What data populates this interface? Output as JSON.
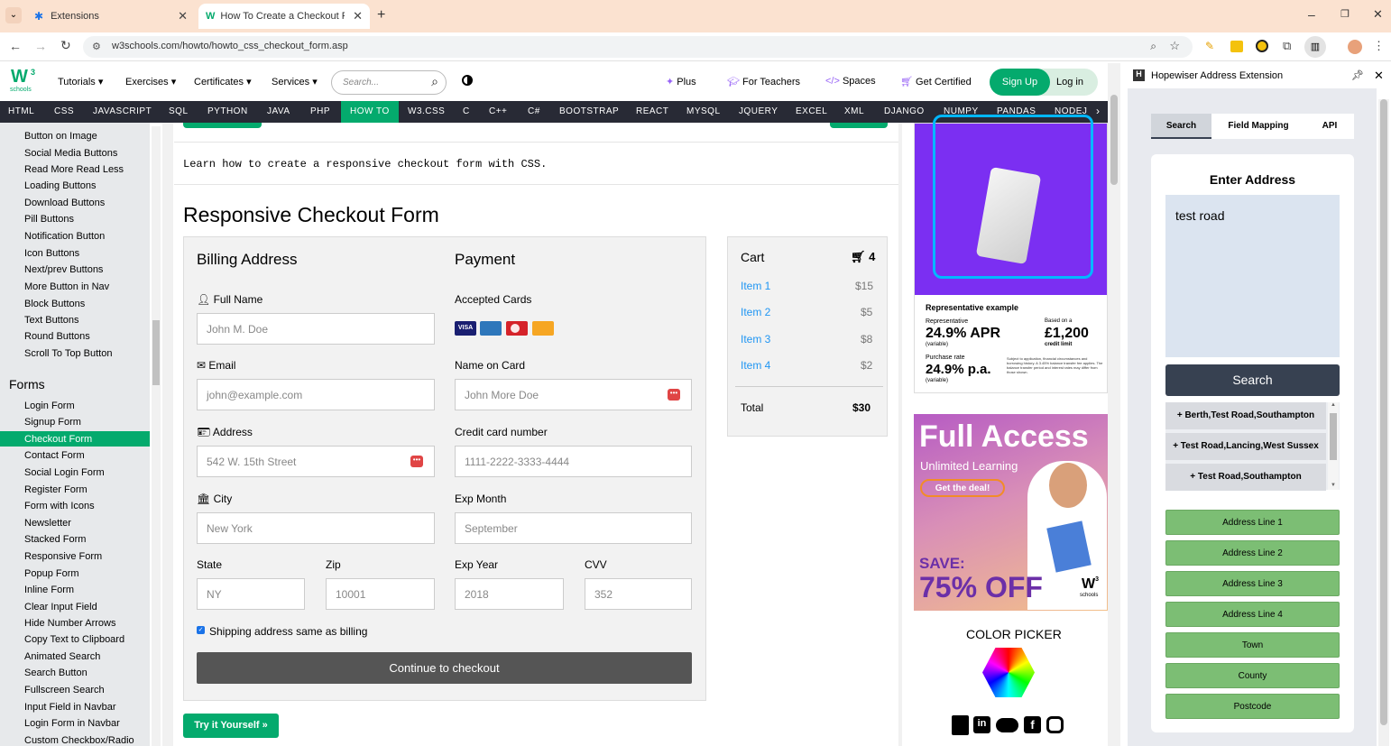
{
  "browser": {
    "tabs": [
      {
        "label": "Extensions"
      },
      {
        "label": "How To Create a Checkout Form"
      }
    ],
    "url": "w3schools.com/howto/howto_css_checkout_form.asp"
  },
  "w3": {
    "logo_text": "schools",
    "nav": [
      "Tutorials",
      "Exercises",
      "Certificates",
      "Services"
    ],
    "search_placeholder": "Search...",
    "right_nav": [
      "Plus",
      "For Teachers",
      "Spaces",
      "Get Certified"
    ],
    "signup": "Sign Up",
    "login": "Log in",
    "topnav": [
      "HTML",
      "CSS",
      "JAVASCRIPT",
      "SQL",
      "PYTHON",
      "JAVA",
      "PHP",
      "HOW TO",
      "W3.CSS",
      "C",
      "C++",
      "C#",
      "BOOTSTRAP",
      "REACT",
      "MYSQL",
      "JQUERY",
      "EXCEL",
      "XML",
      "DJANGO",
      "NUMPY",
      "PANDAS",
      "NODEJ"
    ],
    "active_topnav": "HOW TO"
  },
  "sidebar": {
    "items_top": [
      "Button on Image",
      "Social Media Buttons",
      "Read More Read Less",
      "Loading Buttons",
      "Download Buttons",
      "Pill Buttons",
      "Notification Button",
      "Icon Buttons",
      "Next/prev Buttons",
      "More Button in Nav",
      "Block Buttons",
      "Text Buttons",
      "Round Buttons",
      "Scroll To Top Button"
    ],
    "section": "Forms",
    "items_forms": [
      "Login Form",
      "Signup Form",
      "Checkout Form",
      "Contact Form",
      "Social Login Form",
      "Register Form",
      "Form with Icons",
      "Newsletter",
      "Stacked Form",
      "Responsive Form",
      "Popup Form",
      "Inline Form",
      "Clear Input Field",
      "Hide Number Arrows",
      "Copy Text to Clipboard",
      "Animated Search",
      "Search Button",
      "Fullscreen Search",
      "Input Field in Navbar",
      "Login Form in Navbar",
      "Custom Checkbox/Radio"
    ],
    "active": "Checkout Form"
  },
  "main": {
    "intro": "Learn how to create a responsive checkout form with CSS.",
    "title": "Responsive Checkout Form",
    "billing_heading": "Billing Address",
    "payment_heading": "Payment",
    "fullname_label": "Full Name",
    "fullname_ph": "John M. Doe",
    "email_label": "Email",
    "email_ph": "john@example.com",
    "address_label": "Address",
    "address_ph": "542 W. 15th Street",
    "city_label": "City",
    "city_ph": "New York",
    "state_label": "State",
    "state_ph": "NY",
    "zip_label": "Zip",
    "zip_ph": "10001",
    "accepted_label": "Accepted Cards",
    "card_name_label": "Name on Card",
    "card_name_ph": "John More Doe",
    "cc_label": "Credit card number",
    "cc_ph": "1111-2222-3333-4444",
    "exp_month_label": "Exp Month",
    "exp_month_ph": "September",
    "exp_year_label": "Exp Year",
    "exp_year_ph": "2018",
    "cvv_label": "CVV",
    "cvv_ph": "352",
    "shipping_label": "Shipping address same as billing",
    "checkout_btn": "Continue to checkout",
    "try_btn": "Try it Yourself »",
    "cart": {
      "title": "Cart",
      "count": "4",
      "items": [
        {
          "name": "Item 1",
          "price": "$15"
        },
        {
          "name": "Item 2",
          "price": "$5"
        },
        {
          "name": "Item 3",
          "price": "$8"
        },
        {
          "name": "Item 4",
          "price": "$2"
        }
      ],
      "total_label": "Total",
      "total": "$30"
    }
  },
  "ads": {
    "rep_example": "Representative example",
    "rep_label": "Representative",
    "apr": "24.9% APR",
    "variable": "(variable)",
    "based_on": "Based on a",
    "credit": "£1,200",
    "credit_limit": "credit limit",
    "purchase_rate": "Purchase rate",
    "pa": "24.9% p.a.",
    "fine_print": "Subject to application, financial circumstances and borrowing history. A 3.45% balance transfer fee applies. The balance transfer period and interest rates may differ from those shown.",
    "full_access": "Full Access",
    "unlimited": "Unlimited Learning",
    "deal": "Get the deal!",
    "save": "SAVE:",
    "off": "75% OFF",
    "w3_brand": "schools",
    "color_picker": "COLOR PICKER"
  },
  "extension": {
    "title": "Hopewiser Address Extension",
    "tabs": [
      "Search",
      "Field Mapping",
      "API"
    ],
    "enter_address": "Enter Address",
    "query": "test road",
    "search_btn": "Search",
    "suggestions": [
      "+ Berth,Test Road,Southampton",
      "+ Test Road,Lancing,West Sussex",
      "+ Test Road,Southampton"
    ],
    "fields": [
      "Address Line 1",
      "Address Line 2",
      "Address Line 3",
      "Address Line 4",
      "Town",
      "County",
      "Postcode"
    ]
  },
  "colors": {
    "w3_green": "#04aa6d",
    "topnav_bg": "#282a35",
    "tab_strip": "#fbe2d0",
    "ext_button": "#374151",
    "field_green": "#7cbe74"
  }
}
